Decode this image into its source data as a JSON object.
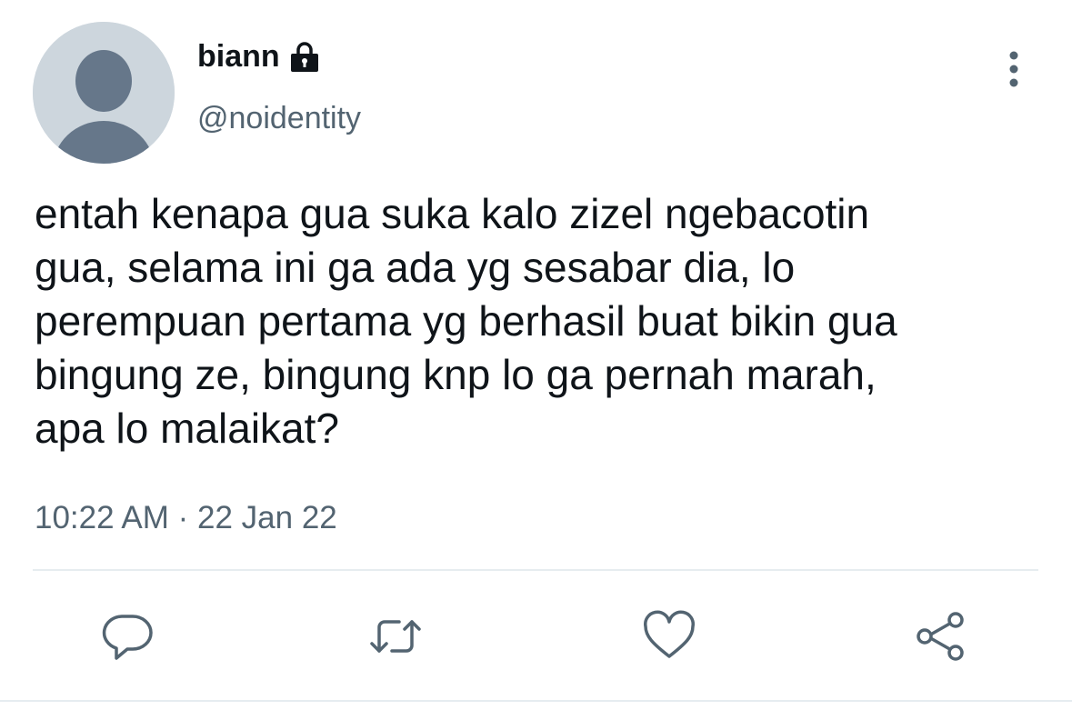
{
  "author": {
    "display_name": "biann",
    "handle": "@noidentity",
    "protected_icon": "lock-icon",
    "avatar": "default-profile-avatar"
  },
  "tweet": {
    "text": "entah kenapa gua suka kalo zizel ngebacotin\ngua, selama ini ga ada yg sesabar dia, lo\nperempuan pertama yg berhasil buat bikin gua\nbingung ze, bingung knp lo ga pernah marah,\napa lo malaikat?",
    "time": "10:22 AM",
    "separator": "·",
    "date": "22 Jan 22"
  },
  "actions": [
    {
      "name": "reply",
      "icon": "reply-icon"
    },
    {
      "name": "retweet",
      "icon": "retweet-icon"
    },
    {
      "name": "like",
      "icon": "heart-icon"
    },
    {
      "name": "share",
      "icon": "share-icon"
    }
  ],
  "colors": {
    "text_primary": "#0f1419",
    "text_secondary": "#536471",
    "avatar_bg": "#cdd6dd",
    "avatar_figure": "#66778a",
    "icon": "#536471",
    "divider": "#e6ecf0"
  }
}
